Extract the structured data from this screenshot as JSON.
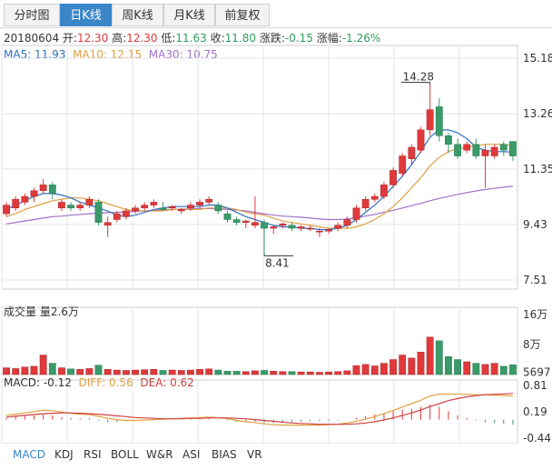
{
  "tabs": [
    {
      "label": "分时图",
      "active": false
    },
    {
      "label": "日K线",
      "active": true
    },
    {
      "label": "周K线",
      "active": false
    },
    {
      "label": "月K线",
      "active": false
    },
    {
      "label": "前复权",
      "active": false
    }
  ],
  "info": {
    "date": "20180604",
    "open_label": "开:",
    "open": "12.30",
    "high_label": "高:",
    "high": "12.30",
    "low_label": "低:",
    "low": "11.63",
    "close_label": "收:",
    "close": "11.80",
    "change_label": "涨跌:",
    "change": "-0.15",
    "pct_label": "涨幅:",
    "pct": "-1.26%"
  },
  "ma_legend": [
    {
      "text": "MA5: 11.93",
      "color": "#2f6fc0"
    },
    {
      "text": "MA10: 12.15",
      "color": "#e0a040"
    },
    {
      "text": "MA30: 10.75",
      "color": "#a070c8"
    }
  ],
  "volume_label": "成交量 量2.6万",
  "macd_legend": [
    {
      "text": "MACD: -0.12",
      "color": "#333333"
    },
    {
      "text": "DIFF: 0.56",
      "color": "#e0a040"
    },
    {
      "text": "DEA: 0.62",
      "color": "#d04040"
    }
  ],
  "bottom_tabs": [
    "MACD",
    "KDJ",
    "RSI",
    "BOLL",
    "W&R",
    "ASI",
    "BIAS",
    "VR"
  ],
  "colors": {
    "up": "#e0393b",
    "down": "#3a9a6a",
    "ma5": "#2f6fc0",
    "ma10": "#e0a040",
    "ma30": "#a070c8",
    "grid": "#e4e4e4",
    "frame": "#cfcfcf"
  },
  "chart_data": [
    {
      "type": "candlestick",
      "price_ticks": [
        "15.18",
        "13.26",
        "11.35",
        "9.43",
        "7.51"
      ],
      "ylim": [
        7.51,
        15.18
      ],
      "annotations": [
        {
          "label": "14.28",
          "index": 46,
          "value": 14.28
        },
        {
          "label": "8.41",
          "index": 28,
          "value": 8.41
        }
      ],
      "candles": [
        [
          9.8,
          10.1,
          10.2,
          9.7
        ],
        [
          10.0,
          10.3,
          10.4,
          9.9
        ],
        [
          10.2,
          10.4,
          10.5,
          10.1
        ],
        [
          10.4,
          10.6,
          10.7,
          10.2
        ],
        [
          10.6,
          10.8,
          11.0,
          10.5
        ],
        [
          10.8,
          10.5,
          10.9,
          10.3
        ],
        [
          10.0,
          10.2,
          10.3,
          9.9
        ],
        [
          10.1,
          10.0,
          10.2,
          9.9
        ],
        [
          10.0,
          10.1,
          10.2,
          9.9
        ],
        [
          10.1,
          10.3,
          10.4,
          10.0
        ],
        [
          10.2,
          9.5,
          10.3,
          9.4
        ],
        [
          9.4,
          9.5,
          9.7,
          9.0
        ],
        [
          9.6,
          9.8,
          9.9,
          9.5
        ],
        [
          9.7,
          9.9,
          10.0,
          9.6
        ],
        [
          9.9,
          10.0,
          10.1,
          9.8
        ],
        [
          10.0,
          10.1,
          10.2,
          9.9
        ],
        [
          10.1,
          10.2,
          10.3,
          10.0
        ],
        [
          10.0,
          9.95,
          10.2,
          9.9
        ],
        [
          10.0,
          10.05,
          10.1,
          9.9
        ],
        [
          9.9,
          9.95,
          10.0,
          9.8
        ],
        [
          10.0,
          10.1,
          10.2,
          9.9
        ],
        [
          10.1,
          10.2,
          10.3,
          10.0
        ],
        [
          10.2,
          10.3,
          10.4,
          10.1
        ],
        [
          10.1,
          9.9,
          10.2,
          9.8
        ],
        [
          9.8,
          9.6,
          9.9,
          9.5
        ],
        [
          9.6,
          9.5,
          9.7,
          9.4
        ],
        [
          9.5,
          9.55,
          9.6,
          9.3
        ],
        [
          9.4,
          9.5,
          10.4,
          9.3
        ],
        [
          9.5,
          9.3,
          9.6,
          8.41
        ],
        [
          9.3,
          9.35,
          9.4,
          9.1
        ],
        [
          9.4,
          9.45,
          9.5,
          9.3
        ],
        [
          9.4,
          9.3,
          9.5,
          9.2
        ],
        [
          9.3,
          9.35,
          9.4,
          9.2
        ],
        [
          9.3,
          9.3,
          9.4,
          9.2
        ],
        [
          9.2,
          9.2,
          9.3,
          9.0
        ],
        [
          9.2,
          9.25,
          9.3,
          9.1
        ],
        [
          9.3,
          9.4,
          9.5,
          9.2
        ],
        [
          9.4,
          9.6,
          9.7,
          9.3
        ],
        [
          9.6,
          10.0,
          10.1,
          9.5
        ],
        [
          10.0,
          10.3,
          10.4,
          9.9
        ],
        [
          10.3,
          10.4,
          10.5,
          10.2
        ],
        [
          10.4,
          10.8,
          10.9,
          10.3
        ],
        [
          10.8,
          11.3,
          11.4,
          10.7
        ],
        [
          11.2,
          11.8,
          11.9,
          11.1
        ],
        [
          11.7,
          12.1,
          12.2,
          11.5
        ],
        [
          12.0,
          12.7,
          12.8,
          11.9
        ],
        [
          12.7,
          13.4,
          14.28,
          12.5
        ],
        [
          13.5,
          12.5,
          13.8,
          12.3
        ],
        [
          12.5,
          12.2,
          12.6,
          11.9
        ],
        [
          12.2,
          11.8,
          12.4,
          11.7
        ],
        [
          12.0,
          12.2,
          12.3,
          11.9
        ],
        [
          12.2,
          11.8,
          12.4,
          11.7
        ],
        [
          11.8,
          12.0,
          12.2,
          10.7
        ],
        [
          11.8,
          12.1,
          12.2,
          11.7
        ],
        [
          12.2,
          12.0,
          12.3,
          11.8
        ],
        [
          12.3,
          11.8,
          12.3,
          11.63
        ]
      ],
      "ma5": [
        9.95,
        10.1,
        10.25,
        10.4,
        10.5,
        10.5,
        10.45,
        10.35,
        10.2,
        10.1,
        10.0,
        9.9,
        9.75,
        9.7,
        9.75,
        9.85,
        9.95,
        10.0,
        10.05,
        10.05,
        10.05,
        10.05,
        10.1,
        10.1,
        10.0,
        9.85,
        9.7,
        9.6,
        9.5,
        9.4,
        9.35,
        9.35,
        9.3,
        9.3,
        9.25,
        9.25,
        9.3,
        9.4,
        9.6,
        9.85,
        10.1,
        10.4,
        10.75,
        11.1,
        11.5,
        11.95,
        12.45,
        12.7,
        12.7,
        12.6,
        12.4,
        12.1,
        12.0,
        11.95,
        11.95,
        11.93
      ],
      "ma10": [
        9.7,
        9.8,
        9.95,
        10.05,
        10.15,
        10.25,
        10.3,
        10.35,
        10.35,
        10.3,
        10.25,
        10.15,
        10.05,
        9.95,
        9.9,
        9.9,
        9.9,
        9.9,
        9.95,
        9.95,
        9.95,
        9.95,
        10.0,
        10.0,
        10.0,
        9.95,
        9.85,
        9.8,
        9.75,
        9.65,
        9.55,
        9.5,
        9.45,
        9.4,
        9.35,
        9.3,
        9.3,
        9.3,
        9.35,
        9.45,
        9.6,
        9.8,
        10.05,
        10.35,
        10.7,
        11.05,
        11.45,
        11.75,
        11.95,
        12.05,
        12.1,
        12.15,
        12.2,
        12.2,
        12.2,
        12.15
      ],
      "ma30": [
        9.45,
        9.5,
        9.55,
        9.6,
        9.65,
        9.7,
        9.72,
        9.75,
        9.78,
        9.8,
        9.82,
        9.84,
        9.85,
        9.86,
        9.88,
        9.9,
        9.92,
        9.94,
        9.95,
        9.96,
        9.97,
        9.98,
        9.98,
        9.97,
        9.95,
        9.93,
        9.9,
        9.85,
        9.8,
        9.75,
        9.72,
        9.7,
        9.68,
        9.65,
        9.62,
        9.6,
        9.6,
        9.62,
        9.66,
        9.72,
        9.78,
        9.85,
        9.92,
        10.0,
        10.08,
        10.16,
        10.25,
        10.33,
        10.4,
        10.47,
        10.53,
        10.59,
        10.64,
        10.68,
        10.72,
        10.75
      ]
    },
    {
      "type": "bar",
      "title": "成交量 量2.6万",
      "y_ticks": [
        "16万",
        "8万",
        "5697"
      ],
      "ylim": [
        0,
        160000
      ],
      "values": [
        18000,
        16000,
        20000,
        22000,
        52000,
        30000,
        18000,
        15000,
        14000,
        16000,
        25000,
        14000,
        12000,
        11000,
        12000,
        13000,
        14000,
        11000,
        12000,
        11000,
        12000,
        14000,
        15000,
        12000,
        9000,
        9000,
        8000,
        10000,
        11000,
        9000,
        8000,
        8000,
        7000,
        7000,
        6000,
        7000,
        8000,
        10000,
        24000,
        27000,
        23000,
        30000,
        40000,
        52000,
        44000,
        60000,
        100000,
        90000,
        48000,
        40000,
        34000,
        30000,
        27000,
        30000,
        22000,
        26000
      ]
    },
    {
      "type": "bar",
      "title": "MACD",
      "y_ticks": [
        "0.81",
        "0.19",
        "-0.44"
      ],
      "ylim": [
        -0.44,
        0.81
      ],
      "macd": [
        0.05,
        0.07,
        0.09,
        0.1,
        0.12,
        0.1,
        0.06,
        0.04,
        0.03,
        0.03,
        -0.02,
        -0.06,
        -0.06,
        -0.04,
        -0.02,
        -0.01,
        0.0,
        0.0,
        0.01,
        0.01,
        0.02,
        0.03,
        0.03,
        0.01,
        -0.02,
        -0.05,
        -0.06,
        -0.05,
        -0.08,
        -0.08,
        -0.07,
        -0.06,
        -0.05,
        -0.04,
        -0.04,
        -0.03,
        -0.02,
        0.0,
        0.04,
        0.08,
        0.12,
        0.16,
        0.2,
        0.24,
        0.26,
        0.3,
        0.36,
        0.3,
        0.2,
        0.1,
        0.04,
        -0.02,
        -0.06,
        -0.08,
        -0.1,
        -0.12
      ],
      "diff": [
        0.1,
        0.13,
        0.16,
        0.19,
        0.22,
        0.21,
        0.18,
        0.15,
        0.13,
        0.12,
        0.08,
        0.03,
        0.0,
        -0.02,
        -0.02,
        -0.01,
        0.0,
        0.01,
        0.02,
        0.03,
        0.04,
        0.05,
        0.06,
        0.05,
        0.02,
        -0.02,
        -0.05,
        -0.07,
        -0.1,
        -0.12,
        -0.13,
        -0.13,
        -0.13,
        -0.13,
        -0.13,
        -0.12,
        -0.11,
        -0.08,
        -0.04,
        0.01,
        0.07,
        0.14,
        0.22,
        0.3,
        0.38,
        0.46,
        0.56,
        0.6,
        0.61,
        0.6,
        0.6,
        0.59,
        0.59,
        0.58,
        0.57,
        0.56
      ],
      "dea": [
        0.06,
        0.08,
        0.1,
        0.12,
        0.14,
        0.15,
        0.16,
        0.16,
        0.15,
        0.14,
        0.13,
        0.11,
        0.09,
        0.07,
        0.05,
        0.04,
        0.03,
        0.02,
        0.02,
        0.02,
        0.03,
        0.03,
        0.04,
        0.04,
        0.04,
        0.03,
        0.02,
        0.0,
        -0.02,
        -0.04,
        -0.06,
        -0.08,
        -0.09,
        -0.1,
        -0.11,
        -0.11,
        -0.11,
        -0.11,
        -0.1,
        -0.08,
        -0.05,
        -0.01,
        0.04,
        0.1,
        0.16,
        0.23,
        0.31,
        0.38,
        0.45,
        0.5,
        0.54,
        0.57,
        0.59,
        0.6,
        0.61,
        0.62
      ]
    }
  ]
}
